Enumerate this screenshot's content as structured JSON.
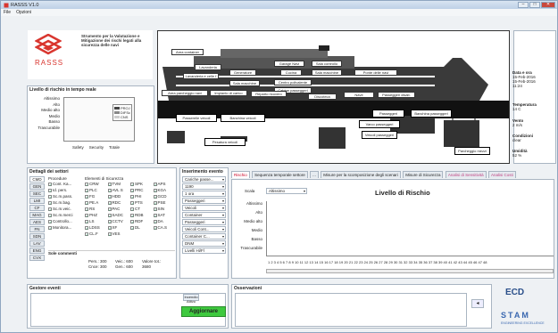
{
  "window": {
    "title": "RASSS V1.0",
    "menu": [
      "File",
      "Opzioni"
    ]
  },
  "logo": {
    "name": "RASSS",
    "tagline": "Strumento per la Valutazione e Mitigazione dei rischi legati alla sicurezza delle navi"
  },
  "risk_panel": {
    "title": "Livello di rischio in tempo reale",
    "levels": [
      "Altissimo",
      "Alto",
      "Medio alto",
      "Medio",
      "Basso",
      "Trascurabile"
    ],
    "legend": [
      "PROJ",
      "DIFSc",
      "CNS"
    ],
    "columns": [
      "Safety",
      "Security",
      "Totale"
    ]
  },
  "ship": {
    "boxes": [
      "Area container",
      "Lavanderia",
      "Lavanderia e celle f",
      "Generatore",
      "Sala macchine",
      "Garage Navi",
      "Cucina",
      "Centro polivalente",
      "Cabine passeggeri",
      "Sala controllo",
      "Sala macchine",
      "Ponte delle navi",
      "Area parcheggio navi",
      "Impianto di carico",
      "Reparto ricovero",
      "Discoteca",
      "Nave",
      "Passeggeri disab.",
      "Passerelle veicoli",
      "Banchina veicoli",
      "Banchina passeggeri",
      "Pesatura veicoli",
      "Passeggeri",
      "Varco passeggeri",
      "Banchina navi",
      "Veicoli passeggeri",
      "Parcheggio mezzi"
    ]
  },
  "side_info": {
    "date_label": "Data e ora",
    "date1": "15-Feb-2016",
    "date2": "15-Feb-2016",
    "time": "11:24",
    "temp_label": "Temperatura",
    "temp": "14 C",
    "wind_label": "Vento",
    "wind": "2 m/s",
    "cond_label": "Condizioni",
    "cond": "clear",
    "hum_label": "Umidità",
    "hum": "52 %"
  },
  "sectors": {
    "title": "Dettagli dei settori",
    "categories": [
      "CMD",
      "GEN",
      "SEC",
      "LMI",
      "CF",
      "MAG",
      "AES",
      "FN",
      "SDN",
      "LAV",
      "ENG",
      "CVX"
    ],
    "col_procedure": "Procedure",
    "col_elements": "Elementi di Sicurezza",
    "procedures": [
      "Cont. Ka...",
      "Id. pers.",
      "Sc.m.pass.",
      "Sc.m.bag.",
      "Sc.m.veic.",
      "Sc.m.merci",
      "Controllo...",
      "Monitora..."
    ],
    "elements": [
      "CRW",
      "TVM",
      "SPK",
      "APS",
      "PLC",
      "AVL S",
      "PRC",
      "KGA",
      "FG",
      "HDD",
      "PHI",
      "GCD",
      "PE.A",
      "RDC",
      "PTS",
      "PSE",
      "RS",
      "PAC",
      "CT",
      "SIN",
      "PHZ",
      "SADC",
      "RDB",
      "SAT",
      "LS",
      "CCTV",
      "RDF",
      "DA",
      "LDSS",
      "XF",
      "DL",
      "CA.S",
      "CL.F",
      "VES"
    ],
    "summary_title": "Sole commenti",
    "summary": [
      "Pers.: 300",
      "Veic.: 600",
      "Valore tot.:",
      "Cnce: 300",
      "Gen.: 600",
      "3680"
    ]
  },
  "events": {
    "title": "Inserimento evento",
    "combos": [
      "Cariche passe...",
      "1190",
      "1 ora",
      "Passeggeri",
      "Veicoli",
      "Container",
      "Passeggeri",
      "Veicoli Cont...",
      "Container C...",
      "DNM",
      "Livelli Hi/Fl"
    ],
    "check_label": "Incendio Attivo",
    "update_button": "Aggiornare"
  },
  "tabs": {
    "items": [
      "Rischio",
      "Sequenza temporale settore",
      "...",
      "Misure per la scomposizione degli scenari",
      "Misure di Sicurezza",
      "Analisi di Sensitività",
      "Analisi Costi"
    ],
    "active": 0
  },
  "chart_panel": {
    "scale_label": "Scala",
    "scale_value": "Altissimo",
    "title": "Livello di Rischio",
    "levels": [
      "Altissimo",
      "Alto",
      "Medio alto",
      "Medio",
      "Basso",
      "Trascurabile"
    ],
    "xaxis": "1 2 3 4 5 6 7 8 9 10 11 12 13 14 15 16 17 18 19 20 21 22 23 24 25 26 27 28 29 30 31 32 33 34 35 36 37 38 39 40 41 42 43 44 45 46 47 48"
  },
  "messages": {
    "title": "Gestore eventi"
  },
  "observations": {
    "title": "Osservazioni"
  },
  "footer": {
    "ecd": "ECD",
    "stam": "STAM",
    "stam_sub": "ENGINEERING EXCELLENCE"
  },
  "chart_data": {
    "type": "line",
    "title": "Livello di Rischio",
    "xlabel": "",
    "ylabel": "",
    "categories": [
      "Altissimo",
      "Alto",
      "Medio alto",
      "Medio",
      "Basso",
      "Trascurabile"
    ],
    "x": [
      1,
      2,
      3,
      4,
      5,
      6,
      7,
      8,
      9,
      10,
      11,
      12,
      13,
      14,
      15,
      16,
      17,
      18,
      19,
      20,
      21,
      22,
      23,
      24,
      25,
      26,
      27,
      28,
      29,
      30,
      31,
      32,
      33,
      34,
      35,
      36,
      37,
      38,
      39,
      40,
      41,
      42,
      43,
      44,
      45,
      46,
      47,
      48
    ],
    "series": []
  },
  "colors": {
    "accent": "#d9362f",
    "tab_active": "#cc0022",
    "update_button": "#3ec93e",
    "stam": "#3a68b0"
  }
}
